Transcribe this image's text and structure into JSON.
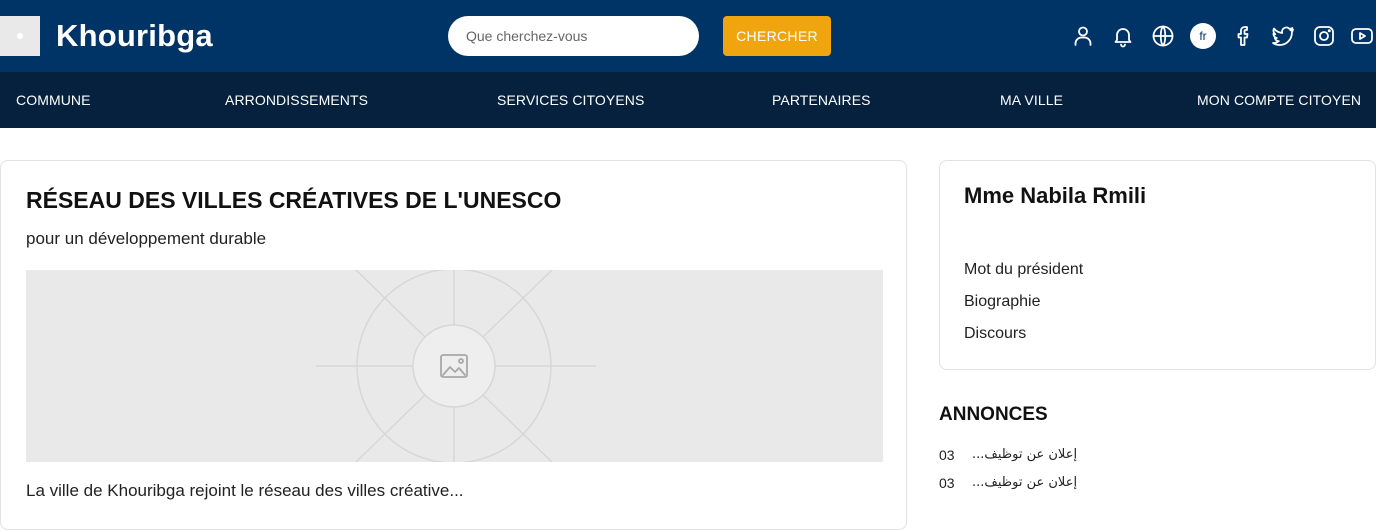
{
  "header": {
    "title": "Khouribga",
    "search_placeholder": "Que cherchez-vous",
    "search_button": "CHERCHER",
    "lang": "fr",
    "icons": [
      "user-icon",
      "bell-icon",
      "globe-icon",
      "language-badge",
      "facebook-icon",
      "twitter-icon",
      "instagram-icon",
      "youtube-icon"
    ]
  },
  "nav": {
    "items": [
      "COMMUNE",
      "ARRONDISSEMENTS",
      "SERVICES CITOYENS",
      "PARTENAIRES",
      "MA VILLE",
      "MON COMPTE CITOYEN"
    ]
  },
  "featured": {
    "title": "RÉSEAU DES VILLES CRÉATIVES DE L'UNESCO",
    "subtitle": "pour un développement durable",
    "image_icon": "image-placeholder-icon",
    "excerpt": "La ville de Khouribga rejoint le réseau des villes créative..."
  },
  "president": {
    "name": "Mme Nabila Rmili",
    "links": [
      "Mot du président",
      "Biographie",
      "Discours"
    ]
  },
  "annonces": {
    "title": "ANNONCES",
    "items": [
      {
        "day": "03",
        "text": "...إعلان عن توظيف"
      },
      {
        "day": "03",
        "text": "...إعلان عن توظيف"
      }
    ]
  },
  "colors": {
    "header_bg": "#003366",
    "nav_bg": "#06213e",
    "accent": "#f0a50f"
  }
}
